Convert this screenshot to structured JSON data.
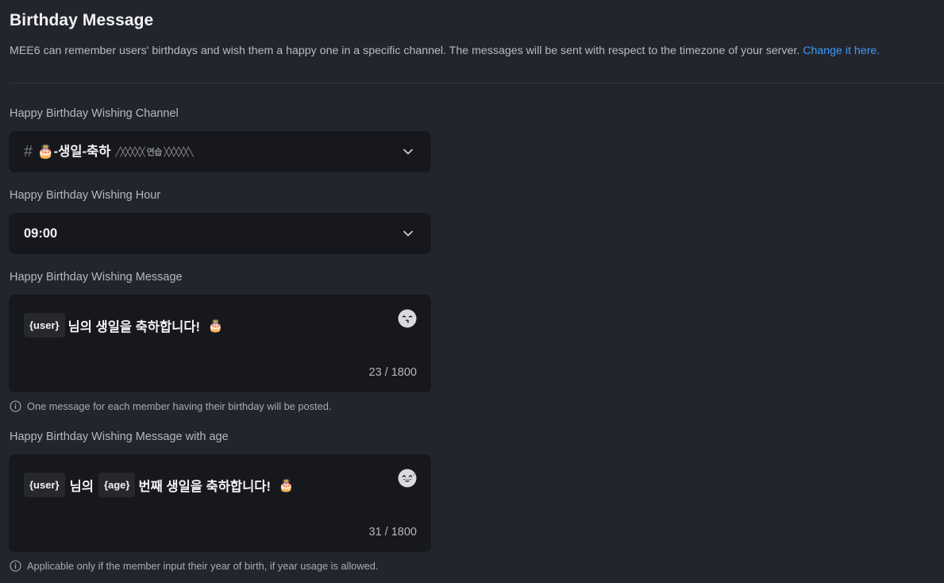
{
  "header": {
    "title": "Birthday Message",
    "description": "MEE6 can remember users' birthdays and wish them a happy one in a specific channel. The messages will be sent with respect to the timezone of your server.",
    "link": "Change it here."
  },
  "channel": {
    "label": "Happy Birthday Wishing Channel",
    "prefix": "#",
    "emoji": "🎂",
    "value": "-생일-축하",
    "decoration": "╱╳╳╳╳╳ 연습 ╳╳╳╳╳╲"
  },
  "hour": {
    "label": "Happy Birthday Wishing Hour",
    "value": "09:00"
  },
  "message": {
    "label": "Happy Birthday Wishing Message",
    "tag_user": "{user}",
    "text": "님의 생일을 축하합니다!",
    "emoji": "🎂",
    "counter": "23 / 1800",
    "help": "One message for each member having their birthday will be posted."
  },
  "message_age": {
    "label": "Happy Birthday Wishing Message with age",
    "tag_user": "{user}",
    "text_mid": "님의",
    "tag_age": "{age}",
    "text": "번째 생일을 축하합니다!",
    "emoji": "🎂",
    "counter": "31 / 1800",
    "help": "Applicable only if the member input their year of birth, if year usage is allowed."
  },
  "icons": {
    "chevron": "chevron-down-icon",
    "emoji_picker": "emoji-picker-icon",
    "info": "info-icon"
  }
}
